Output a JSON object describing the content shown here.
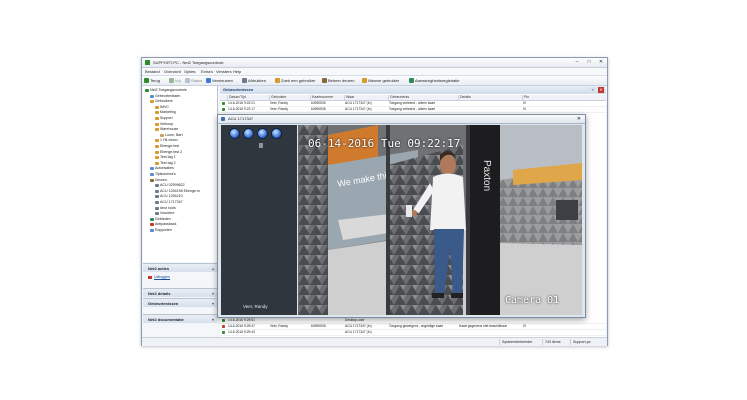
{
  "window": {
    "title": "SUPPORT-PC - Net2 Toegangscontrole",
    "controls": [
      "–",
      "□",
      "✕"
    ]
  },
  "menu": [
    "Bestand",
    "Overzicht",
    "Opties",
    "Extra's",
    "Vensters",
    "Help"
  ],
  "toolbar": {
    "back": "Terug",
    "forward": "Vrij",
    "forward_extra": "Status",
    "refresh": "Vernieuwen",
    "print": "Afdrukken",
    "find_user": "Zoek een gebruiker",
    "manage_doors": "Beheer deuren",
    "new_user": "Nieuwe gebruiker",
    "registration": "Aanwezigheidsregistratie"
  },
  "tree": [
    {
      "label": "Net2 Toegangscontrole",
      "level": 0
    },
    {
      "label": "Gebeurtenissen",
      "level": 1
    },
    {
      "label": "Gebruikers",
      "level": 1
    },
    {
      "label": "IMVC",
      "level": 2
    },
    {
      "label": "Marketing",
      "level": 2
    },
    {
      "label": "Support",
      "level": 2
    },
    {
      "label": "Verkoop",
      "level": 2
    },
    {
      "label": "Warehouse",
      "level": 2
    },
    {
      "label": "Loom, Bart",
      "level": 3
    },
    {
      "label": "1 Hit vision",
      "level": 2
    },
    {
      "label": "Ebenge.test",
      "level": 2
    },
    {
      "label": "Ebenge.test 2",
      "level": 2
    },
    {
      "label": "Test tag 1",
      "level": 2
    },
    {
      "label": "Test tag 2",
      "level": 2
    },
    {
      "label": "Autorisaties",
      "level": 1
    },
    {
      "label": "Tijdschema's",
      "level": 1
    },
    {
      "label": "Deuren",
      "level": 1
    },
    {
      "label": "ACU 02599622",
      "level": 2
    },
    {
      "label": "ACU 1254198 Ebenge.m",
      "level": 2
    },
    {
      "label": "ACU 1254210",
      "level": 2
    },
    {
      "label": "ACU 1717347",
      "level": 2
    },
    {
      "label": "deur tools",
      "level": 2
    },
    {
      "label": "Voordeur",
      "level": 2
    },
    {
      "label": "Gebieden",
      "level": 1
    },
    {
      "label": "Antipassback",
      "level": 1
    },
    {
      "label": "Rapporten",
      "level": 1
    }
  ],
  "panels": {
    "actions": "Net2 acties",
    "actions_item": "Uitloggen",
    "details": "Net2 details",
    "events": "Gebeurtenissen",
    "docs": "Net2 documentatie"
  },
  "events_header": "Gebeurtenissen",
  "columns": [
    "Datum/Tijd",
    "Gebruiker",
    "Kaartnummer",
    "Waar",
    "Gebeurtenis",
    "Details",
    "Pin"
  ],
  "rows_top": [
    [
      "14-6-2016 9:22:21",
      "Veer, Randy",
      "64990535",
      "ACU 1717347 (In)",
      "Toegang verleend - alleen kaart",
      "",
      "IV"
    ],
    [
      "14-6-2016 9:22:17",
      "Veer, Randy",
      "64990535",
      "ACU 1717347 (In)",
      "Toegang verleend - alleen kaart",
      "",
      "IV"
    ]
  ],
  "rows_bottom": [
    [
      "14-6-2016 9:29:51",
      "",
      "",
      "Desktop-user",
      "",
      "",
      ""
    ],
    [
      "14-6-2016 9:29:47",
      "Veer, Randy",
      "64990535",
      "ACU 1717347 (In)",
      "Toegang geweigerd - ongeldige kaart",
      "Kaart gegevens niet beschikbaar",
      "IV"
    ],
    [
      "14-6-2016 9:29:43",
      "",
      "",
      "ACU 1717347 (In)",
      "",
      "",
      ""
    ]
  ],
  "status": {
    "user": "Systeembeheerder",
    "count": "743 items",
    "pc": "Support-pc"
  },
  "camera": {
    "window_title": "ACU 1717347",
    "timestamp": "06-14-2016 Tue 09:22:17",
    "camera_label": "Camera 01",
    "person_name": "Veer, Randy",
    "pause_symbol": "II",
    "wall_text": "We make things",
    "brand_text": "Paxton"
  },
  "colors": {
    "accent": "#1b3a66",
    "play_button": "#3b78d8",
    "video_bg": "#5a5b5e"
  }
}
